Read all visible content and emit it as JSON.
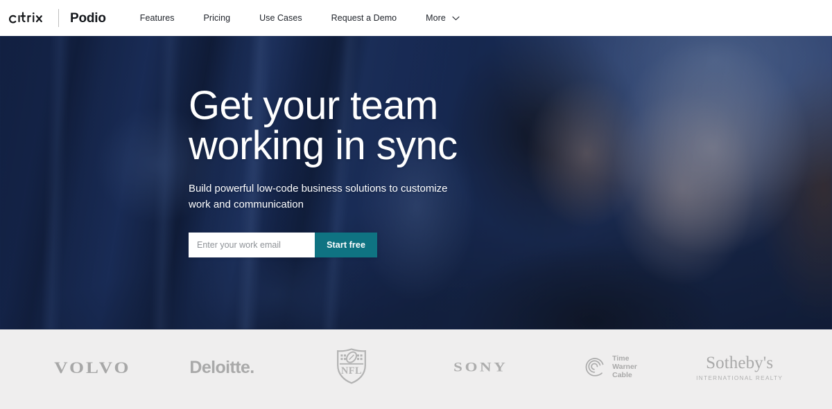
{
  "header": {
    "brand": {
      "citrix_label": "citrix",
      "divider": "|",
      "product_label": "Podio"
    },
    "nav_items": [
      {
        "label": "Features",
        "icon": null
      },
      {
        "label": "Pricing",
        "icon": null
      },
      {
        "label": "Use Cases",
        "icon": null
      },
      {
        "label": "Request a Demo",
        "icon": null
      },
      {
        "label": "More",
        "icon": "chevron-down-icon"
      }
    ]
  },
  "hero": {
    "title_line1": "Get your team",
    "title_line2": "working in sync",
    "subtitle": "Build powerful low-code business solutions to customize work and communication",
    "signup": {
      "email_placeholder": "Enter your work email",
      "email_value": "",
      "cta_label": "Start free",
      "cta_color": "#0f7382"
    },
    "background_alt": "Two smiling women at a desk with computer monitors, blue brand overlay"
  },
  "logo_bar": {
    "background_color": "#efeeee",
    "logos": [
      {
        "name": "volvo",
        "label": "VOLVO"
      },
      {
        "name": "deloitte",
        "label": "Deloitte."
      },
      {
        "name": "nfl",
        "label": "NFL"
      },
      {
        "name": "sony",
        "label": "SONY"
      },
      {
        "name": "time-warner-cable",
        "line1": "Time",
        "line2": "Warner",
        "line3": "Cable"
      },
      {
        "name": "sothebys",
        "label": "Sotheby's",
        "sublabel": "INTERNATIONAL REALTY"
      }
    ]
  }
}
